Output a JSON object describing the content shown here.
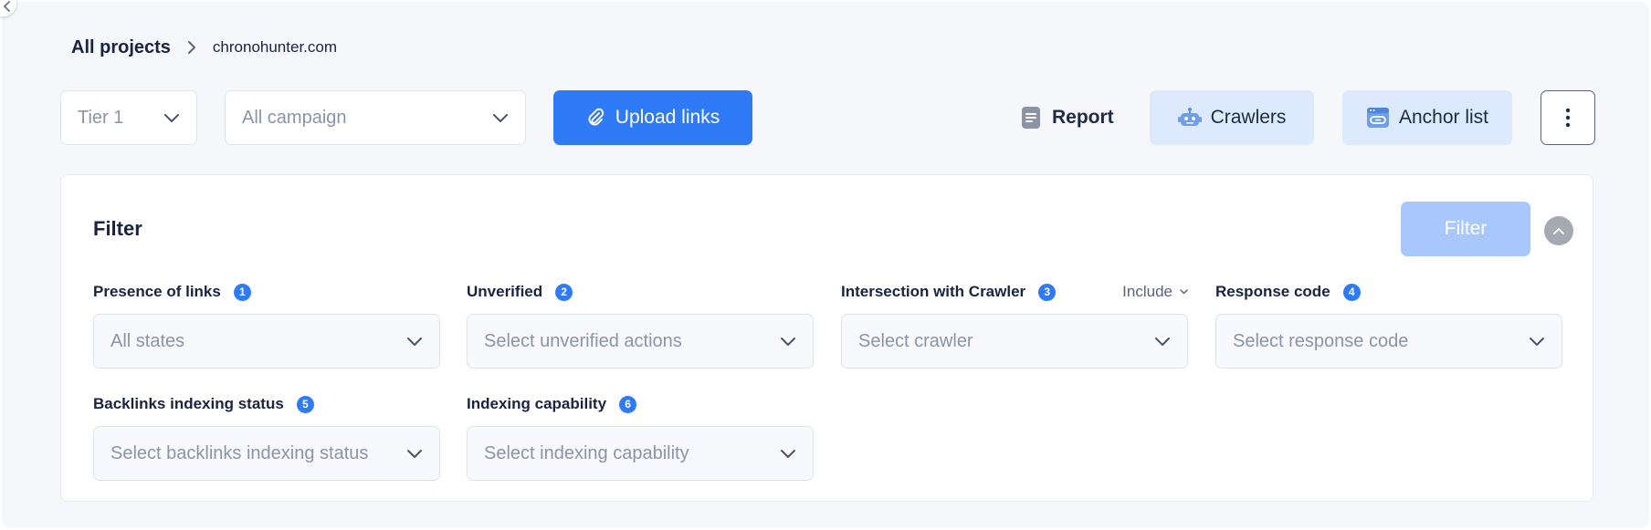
{
  "breadcrumb": {
    "root": "All projects",
    "current": "chronohunter.com"
  },
  "toolbar": {
    "tier_value": "Tier 1",
    "campaign_placeholder": "All campaign",
    "upload_label": "Upload links",
    "report_label": "Report",
    "crawlers_label": "Crawlers",
    "anchor_list_label": "Anchor list"
  },
  "filter": {
    "title": "Filter",
    "filter_button": "Filter",
    "fields": [
      {
        "number": "1",
        "label": "Presence of links",
        "placeholder": "All states"
      },
      {
        "number": "2",
        "label": "Unverified",
        "placeholder": "Select unverified actions"
      },
      {
        "number": "3",
        "label": "Intersection with Crawler",
        "placeholder": "Select crawler",
        "mode": "Include"
      },
      {
        "number": "4",
        "label": "Response code",
        "placeholder": "Select response code"
      },
      {
        "number": "5",
        "label": "Backlinks indexing status",
        "placeholder": "Select backlinks indexing status"
      },
      {
        "number": "6",
        "label": "Indexing capability",
        "placeholder": "Select indexing capability"
      }
    ]
  },
  "icons": {
    "collapse_sidebar": "chevron-left-icon",
    "breadcrumb_separator": "chevron-right-icon",
    "dropdown": "chevron-down-icon",
    "upload": "paperclip-icon",
    "report": "report-icon",
    "crawlers": "robot-icon",
    "anchor_list": "anchor-list-icon",
    "more": "kebab-menu-icon",
    "collapse_panel": "chevron-up-icon"
  },
  "colors": {
    "primary": "#2f7af6",
    "primary_disabled": "#a8c8fb",
    "soft_button": "#dde9fc",
    "page_background": "#f5f7fa",
    "text_dark": "#1a2340",
    "placeholder": "#8a94a6"
  }
}
